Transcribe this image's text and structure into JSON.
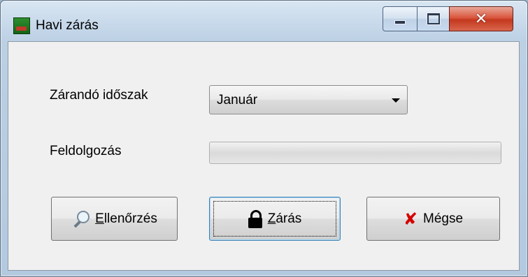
{
  "window": {
    "title": "Havi zárás",
    "controls": {
      "close_glyph": "✕"
    }
  },
  "form": {
    "period_label": "Zárandó időszak",
    "period_value": "Január",
    "process_label": "Feldolgozás",
    "progress_percent": 0
  },
  "buttons": {
    "check": {
      "mnemonic": "E",
      "rest": "llenőrzés",
      "icon": "magnifier-icon"
    },
    "close": {
      "mnemonic": "Z",
      "rest": "árás",
      "icon": "lock-icon"
    },
    "cancel": {
      "label": "Mégse",
      "icon": "x-icon",
      "icon_glyph": "✘"
    }
  },
  "colors": {
    "cancel_icon": "#d40000",
    "close_button_accent": "#3c7fb1"
  }
}
